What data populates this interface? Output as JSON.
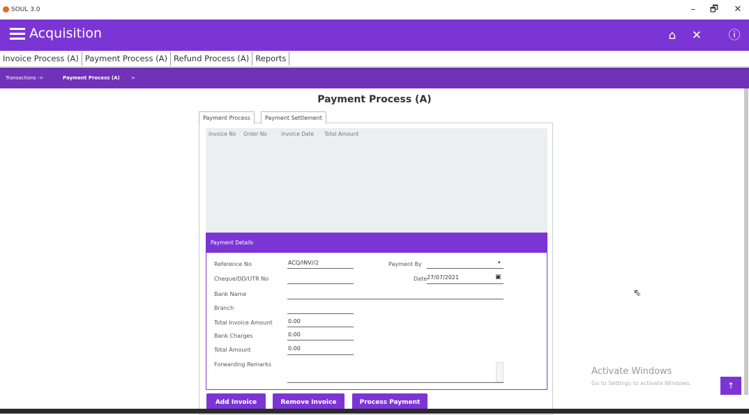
{
  "window": {
    "title": "SOUL 3.0",
    "minimize": "–",
    "maximize": "🗗",
    "close": "✕"
  },
  "appbar": {
    "title": "Acquisition",
    "home_icon": "home-icon",
    "close_icon": "close-icon",
    "help_icon": "help-icon",
    "home_glyph": "⌂",
    "close_glyph": "✕",
    "help_glyph": "ⓘ"
  },
  "tabs": [
    "Invoice Process (A)",
    "Payment Process (A)",
    "Refund Process (A)",
    "Reports"
  ],
  "breadcrumb": {
    "part1": "Transactions ->",
    "part2": "Payment Process (A)",
    "part3": ">"
  },
  "page_title": "Payment Process (A)",
  "subtabs": [
    "Payment Process",
    "Payment Settlement"
  ],
  "grid": {
    "columns": [
      "Invoice No",
      "Order No",
      "Invoice Date",
      "Total Amount"
    ]
  },
  "details": {
    "header": "Payment Details",
    "reference_no": {
      "label": "Reference No",
      "value": "ACQ/INV//2"
    },
    "payment_by": {
      "label": "Payment By",
      "value": ""
    },
    "cheque": {
      "label": "Cheque/DD/UTR No",
      "value": ""
    },
    "date": {
      "label": "Date",
      "value": "27/07/2021"
    },
    "bank_name": {
      "label": "Bank Name",
      "value": ""
    },
    "branch": {
      "label": "Branch",
      "value": ""
    },
    "total_invoice_amount": {
      "label": "Total Invoice Amount",
      "value": "0.00"
    },
    "bank_charges": {
      "label": "Bank Charges",
      "value": "0.00"
    },
    "total_amount": {
      "label": "Total Amount",
      "value": "0.00"
    },
    "forwarding_remarks": {
      "label": "Forwarding Remarks",
      "value": ""
    }
  },
  "buttons": {
    "add_invoice": "Add Invoice",
    "remove_invoice": "Remove Invoice",
    "process_payment": "Process Payment"
  },
  "watermark": {
    "line1": "Activate Windows",
    "line2": "Go to Settings to activate Windows."
  },
  "fab": "↑",
  "colors": {
    "accent": "#7c35d5",
    "breadcrumb_bar": "#6f32b8"
  }
}
